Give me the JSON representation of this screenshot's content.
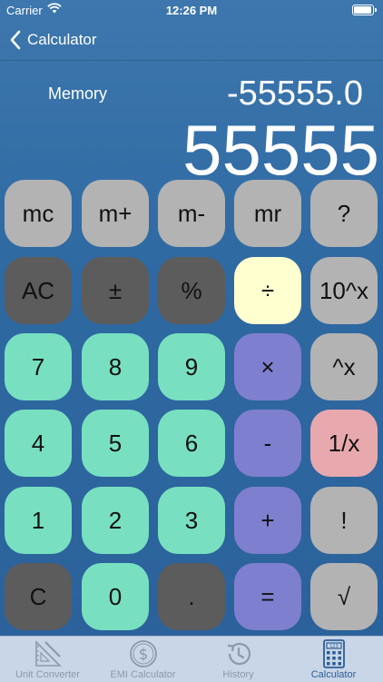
{
  "status_bar": {
    "carrier": "Carrier",
    "time": "12:26 PM"
  },
  "nav": {
    "back_label": "Calculator"
  },
  "display": {
    "memory_label": "Memory",
    "memory_value": "-55555.0",
    "main_value": "55555"
  },
  "keys": {
    "mc": "mc",
    "mplus": "m+",
    "mminus": "m-",
    "mr": "mr",
    "help": "?",
    "ac": "AC",
    "plusminus": "±",
    "percent": "%",
    "divide": "÷",
    "pow10": "10^x",
    "seven": "7",
    "eight": "8",
    "nine": "9",
    "multiply": "×",
    "power": "^x",
    "four": "4",
    "five": "5",
    "six": "6",
    "minus": "-",
    "reciprocal": "1/x",
    "one": "1",
    "two": "2",
    "three": "3",
    "plus": "+",
    "factorial": "!",
    "clear": "C",
    "zero": "0",
    "dot": ".",
    "equals": "=",
    "sqrt": "√"
  },
  "tabs": [
    {
      "label": "Unit Converter",
      "icon": "ruler-triangle-icon"
    },
    {
      "label": "EMI Calculator",
      "icon": "dollar-coin-icon"
    },
    {
      "label": "History",
      "icon": "history-clock-icon"
    },
    {
      "label": "Calculator",
      "icon": "calculator-icon",
      "active": true
    }
  ],
  "colors": {
    "background": "#2f69a2",
    "key_gray": "#b3b3b3",
    "key_dark": "#5c5c5c",
    "key_digit": "#78e0c0",
    "key_operator": "#7f7fcf",
    "key_selected": "#ffffd0",
    "key_reciprocal": "#e8a9ae",
    "tab_active": "#2c5d95"
  }
}
